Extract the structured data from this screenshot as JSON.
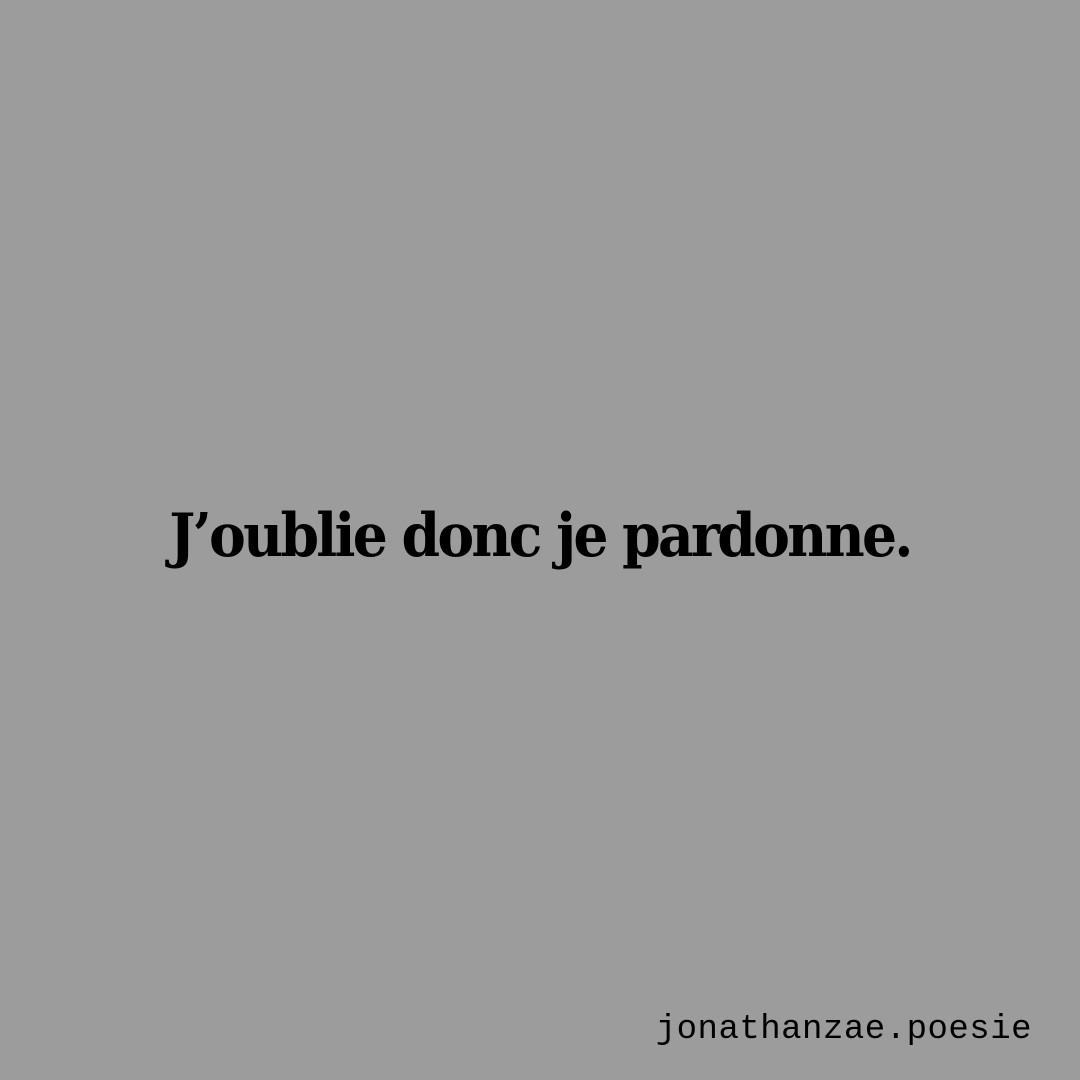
{
  "quote": {
    "text": "J’oublie donc je pardonne."
  },
  "footer": {
    "handle": "jonathanzae.poesie"
  },
  "colors": {
    "background": "#9c9c9c",
    "text": "#000000"
  }
}
